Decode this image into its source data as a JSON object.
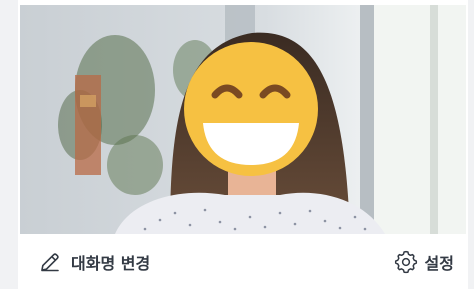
{
  "actions": {
    "rename_label": "대화명 변경",
    "settings_label": "설정"
  },
  "icons": {
    "rename": "pencil-icon",
    "settings": "gear-icon",
    "face": "grinning-emoji"
  },
  "colors": {
    "text": "#333a44",
    "icon": "#333a44",
    "emoji": "#f6c142"
  }
}
